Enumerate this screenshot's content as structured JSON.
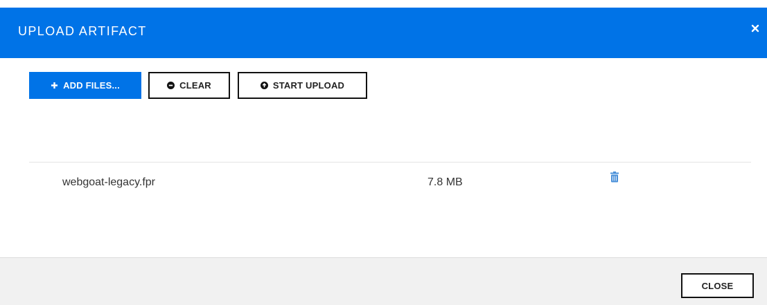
{
  "dialog": {
    "title": "UPLOAD ARTIFACT",
    "close_icon": "close-icon"
  },
  "toolbar": {
    "add_files_label": "ADD FILES...",
    "clear_label": "CLEAR",
    "start_upload_label": "START UPLOAD"
  },
  "files": [
    {
      "name": "webgoat-legacy.fpr",
      "size": "7.8 MB",
      "action_icon": "trash-icon"
    }
  ],
  "footer": {
    "close_label": "CLOSE"
  },
  "colors": {
    "accent": "#0073e7",
    "footer_bg": "#f1f1f1"
  }
}
